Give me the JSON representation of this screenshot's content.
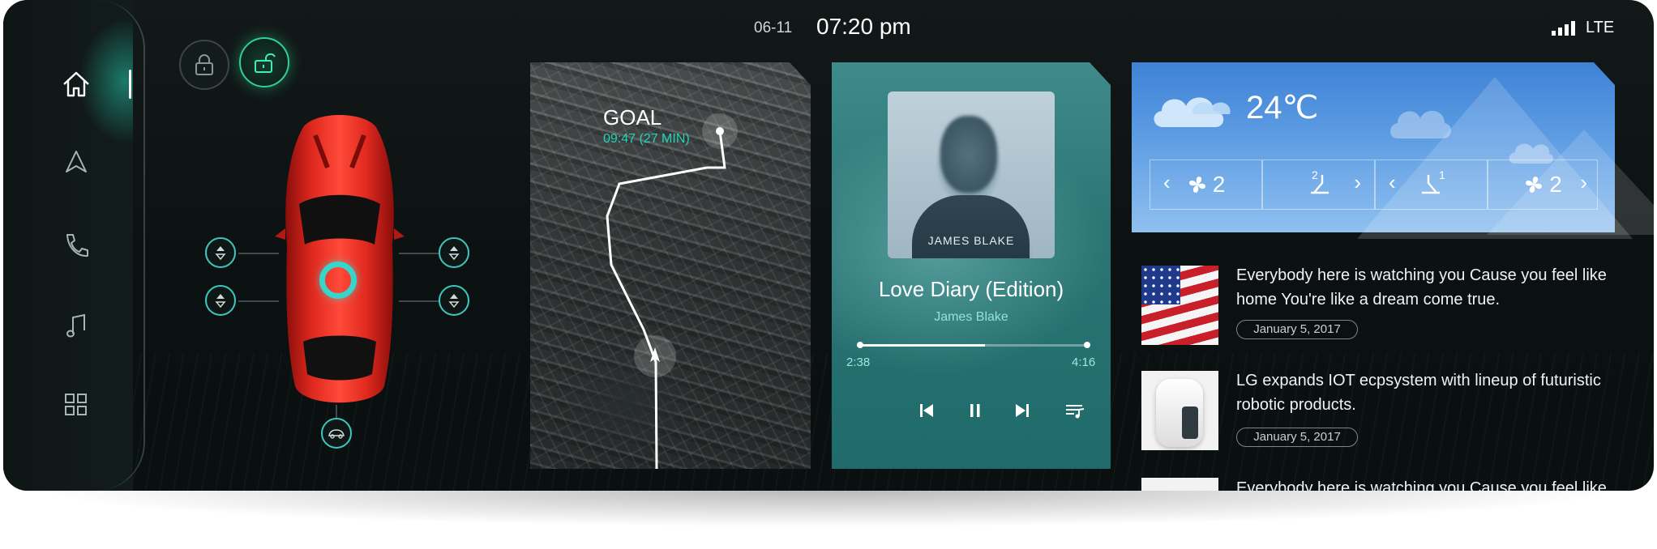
{
  "status": {
    "date": "06-11",
    "time": "07:20 pm",
    "network": "LTE"
  },
  "sidebar": {
    "items": [
      {
        "name": "home-icon",
        "active": true
      },
      {
        "name": "navigation-icon",
        "active": false
      },
      {
        "name": "phone-icon",
        "active": false
      },
      {
        "name": "music-icon",
        "active": false
      },
      {
        "name": "apps-icon",
        "active": false
      }
    ]
  },
  "locks": {
    "locked_icon": "lock-closed-icon",
    "unlocked_icon": "lock-open-icon",
    "active": "unlocked"
  },
  "map": {
    "goal_label": "GOAL",
    "eta": "09:47 (27 MIN)"
  },
  "music": {
    "album_text": "JAMES BLAKE",
    "title": "Love Diary (Edition)",
    "artist": "James Blake",
    "current_time": "2:38",
    "total_time": "4:16",
    "progress": 0.55
  },
  "weather": {
    "temperature": "24℃",
    "fan_left": "2",
    "seat_left": "2",
    "seat_right": "1",
    "fan_right": "2"
  },
  "news": [
    {
      "text": "Everybody here is watching you Cause you feel like home You're like a dream come true.",
      "date": "January 5, 2017",
      "image": "us-flag"
    },
    {
      "text": "LG expands IOT ecpsystem with lineup of futuristic robotic products.",
      "date": "January 5, 2017",
      "image": "robot"
    },
    {
      "text": "Everybody here is watching you Cause you feel like",
      "date": "",
      "image": "robot"
    }
  ],
  "colors": {
    "accent": "#2fd09a",
    "teal": "#3cc8c0",
    "music_bg": "#2b7575",
    "weather_bg": "#4a8fdc",
    "car_red": "#d8231b"
  }
}
